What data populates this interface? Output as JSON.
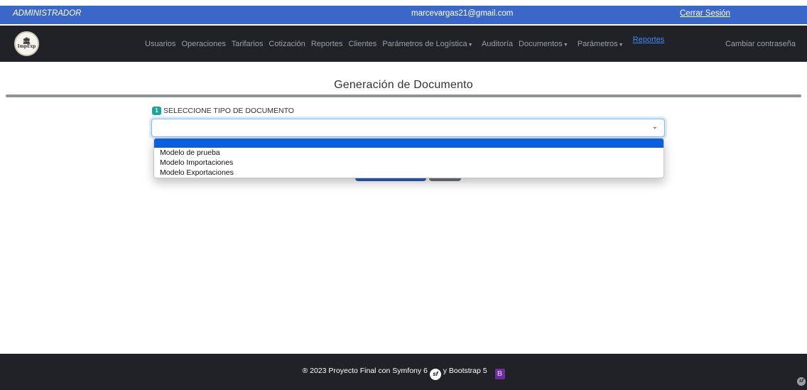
{
  "topbar": {
    "role": "ADMINISTRADOR",
    "email": "marcevargas21@gmail.com",
    "logout": "Cerrar Sesión"
  },
  "navbar": {
    "logo_text": "ImpExp",
    "items": [
      {
        "label": "Usuarios"
      },
      {
        "label": "Operaciones"
      },
      {
        "label": "Tarifarios"
      },
      {
        "label": "Cotización"
      },
      {
        "label": "Reportes"
      },
      {
        "label": "Clientes"
      },
      {
        "label": "Parámetros de Logística"
      },
      {
        "label": "Auditoría"
      },
      {
        "label": "Documentos"
      },
      {
        "label": "Parámetros"
      },
      {
        "label": "Reportes"
      }
    ],
    "change_password": "Cambiar contraseña"
  },
  "main": {
    "title": "Generación de Documento",
    "step_number": "1",
    "step_label": "SELECCIONE TIPO DE DOCUMENTO",
    "select_value": "",
    "options": [
      "Modelo de prueba",
      "Modelo Importaciones",
      "Modelo Exportaciones"
    ]
  },
  "footer": {
    "text_prefix": "® 2023 Proyecto Final con Symfony 6",
    "text_mid": "y Bootstrap 5",
    "sf_logo": "sf",
    "bs_logo": "B"
  },
  "colors": {
    "topbar": "#3b68c8",
    "navbar": "#202227",
    "badge": "#1aa59a",
    "highlight": "#0a5ee0"
  }
}
